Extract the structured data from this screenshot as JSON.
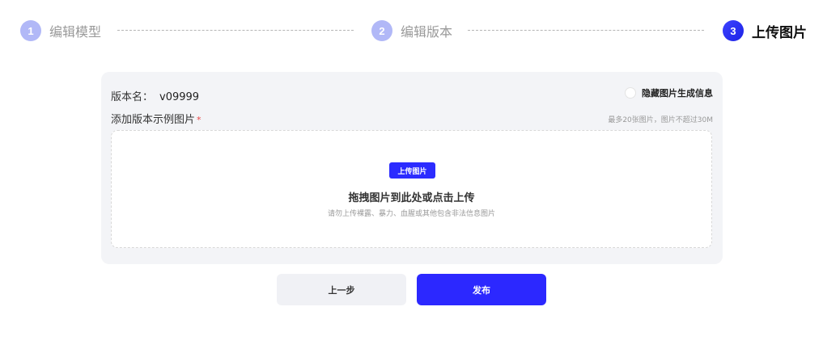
{
  "stepper": {
    "steps": [
      {
        "num": "1",
        "label": "编辑模型",
        "state": "inactive"
      },
      {
        "num": "2",
        "label": "编辑版本",
        "state": "inactive"
      },
      {
        "num": "3",
        "label": "上传图片",
        "state": "active"
      }
    ]
  },
  "form": {
    "version_label": "版本名：",
    "version_value": "v09999",
    "hide_info_label": "隐藏图片生成信息",
    "add_images_label": "添加版本示例图片",
    "required_mark": "*",
    "limit_text": "最多20张图片，图片不超过30M"
  },
  "dropzone": {
    "upload_button": "上传图片",
    "drag_text": "拖拽图片到此处或点击上传",
    "warning_text": "请勿上传裸露、暴力、血腥或其他包含非法信息图片"
  },
  "actions": {
    "prev_label": "上一步",
    "publish_label": "发布"
  },
  "colors": {
    "accent": "#2c28ff",
    "inactive_step": "#b1b8f7",
    "card_bg": "#f3f4f7"
  }
}
